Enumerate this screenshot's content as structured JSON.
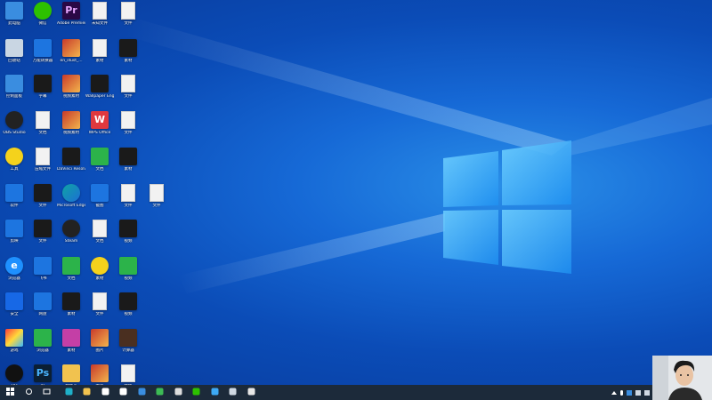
{
  "desktop": {
    "icons": [
      {
        "label": "此电脑",
        "glyph": "pc"
      },
      {
        "label": "微信",
        "glyph": "wechat"
      },
      {
        "label": "Adobe Premiere ...",
        "glyph": "pr"
      },
      {
        "label": "未知文件",
        "glyph": "file"
      },
      {
        "label": "文件",
        "glyph": "file"
      },
      {
        "label": "回收站",
        "glyph": "recycle"
      },
      {
        "label": "万能转换器",
        "glyph": "blue"
      },
      {
        "label": "en_illust_...",
        "glyph": "photo"
      },
      {
        "label": "素材",
        "glyph": "file"
      },
      {
        "label": "素材",
        "glyph": "dark"
      },
      {
        "label": "控制面板",
        "glyph": "pc"
      },
      {
        "label": "字幕",
        "glyph": "dark"
      },
      {
        "label": "视频素材",
        "glyph": "photo"
      },
      {
        "label": "Wallpaper Engine",
        "glyph": "dark"
      },
      {
        "label": "文件",
        "glyph": "file"
      },
      {
        "label": "OBS Studio",
        "glyph": "obs"
      },
      {
        "label": "文档",
        "glyph": "file"
      },
      {
        "label": "视频素材",
        "glyph": "photo"
      },
      {
        "label": "WPS Office",
        "glyph": "wps"
      },
      {
        "label": "文件",
        "glyph": "file"
      },
      {
        "label": "工具",
        "glyph": "yellow"
      },
      {
        "label": "压缩文件",
        "glyph": "file"
      },
      {
        "label": "DaVinci Resolve",
        "glyph": "dark"
      },
      {
        "label": "文档",
        "glyph": "green"
      },
      {
        "label": "素材",
        "glyph": "dark"
      },
      {
        "label": "软件",
        "glyph": "blue"
      },
      {
        "label": "文件",
        "glyph": "dark"
      },
      {
        "label": "Microsoft Edge",
        "glyph": "edge"
      },
      {
        "label": "截图",
        "glyph": "blue"
      },
      {
        "label": "文件",
        "glyph": "file"
      },
      {
        "label": "文件",
        "glyph": "file"
      },
      {
        "label": "剪映",
        "glyph": "blue"
      },
      {
        "label": "文件",
        "glyph": "dark"
      },
      {
        "label": "Steam",
        "glyph": "obs"
      },
      {
        "label": "文档",
        "glyph": "file"
      },
      {
        "label": "视频",
        "glyph": "dark"
      },
      {
        "label": "浏览器",
        "glyph": "ie"
      },
      {
        "label": "飞书",
        "glyph": "blue"
      },
      {
        "label": "文档",
        "glyph": "green"
      },
      {
        "label": "素材",
        "glyph": "yellow"
      },
      {
        "label": "视频",
        "glyph": "green"
      },
      {
        "label": "安全",
        "glyph": "shield"
      },
      {
        "label": "网盘",
        "glyph": "blue"
      },
      {
        "label": "素材",
        "glyph": "dark"
      },
      {
        "label": "文件",
        "glyph": "file"
      },
      {
        "label": "视频",
        "glyph": "dark"
      },
      {
        "label": "游戏",
        "glyph": "gaming"
      },
      {
        "label": "浏览器",
        "glyph": "green"
      },
      {
        "label": "素材",
        "glyph": "pink"
      },
      {
        "label": "图片",
        "glyph": "photo"
      },
      {
        "label": "计算器",
        "glyph": "calc"
      },
      {
        "label": "QQ",
        "glyph": "qq"
      },
      {
        "label": "Ps",
        "glyph": "ps"
      },
      {
        "label": "文件夹",
        "glyph": "folder"
      },
      {
        "label": "图片",
        "glyph": "photo"
      },
      {
        "label": "文件",
        "glyph": "file"
      }
    ]
  },
  "taskbar": {
    "icons": [
      {
        "name": "start"
      },
      {
        "name": "search"
      },
      {
        "name": "task-view"
      },
      {
        "name": "edge"
      },
      {
        "name": "file-explorer"
      },
      {
        "name": "store"
      },
      {
        "name": "mail"
      },
      {
        "name": "feishu"
      },
      {
        "name": "app-green"
      },
      {
        "name": "obs"
      },
      {
        "name": "wechat"
      },
      {
        "name": "browser"
      },
      {
        "name": "steam"
      },
      {
        "name": "photos"
      }
    ]
  },
  "colors": {
    "taskbar": "#1c2a3a",
    "accent": "#1669d6"
  }
}
